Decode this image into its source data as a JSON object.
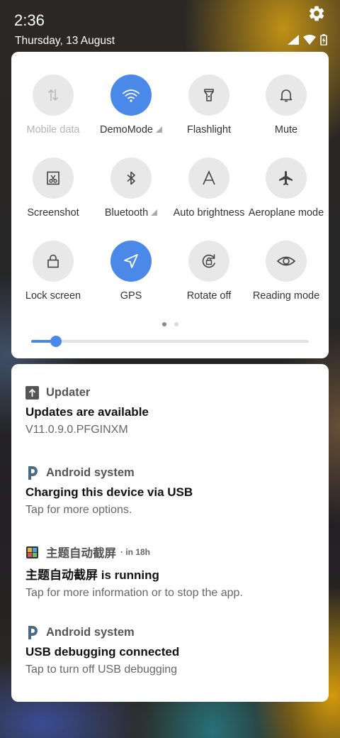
{
  "status_bar": {
    "time": "2:36",
    "date": "Thursday, 13 August"
  },
  "quick_settings": {
    "tiles": [
      {
        "label": "Mobile data",
        "icon": "mobile-data-icon",
        "active": false,
        "disabled": true
      },
      {
        "label": "DemoMode",
        "icon": "wifi-icon",
        "active": true,
        "has_menu": true
      },
      {
        "label": "Flashlight",
        "icon": "flashlight-icon",
        "active": false
      },
      {
        "label": "Mute",
        "icon": "bell-icon",
        "active": false
      },
      {
        "label": "Screenshot",
        "icon": "screenshot-icon",
        "active": false
      },
      {
        "label": "Bluetooth",
        "icon": "bluetooth-icon",
        "active": false,
        "has_menu": true
      },
      {
        "label": "Auto brightness",
        "icon": "auto-brightness-icon",
        "active": false
      },
      {
        "label": "Aeroplane mode",
        "icon": "airplane-icon",
        "active": false
      },
      {
        "label": "Lock screen",
        "icon": "lock-icon",
        "active": false
      },
      {
        "label": "GPS",
        "icon": "location-icon",
        "active": true
      },
      {
        "label": "Rotate off",
        "icon": "rotate-lock-icon",
        "active": false
      },
      {
        "label": "Reading mode",
        "icon": "eye-icon",
        "active": false
      }
    ],
    "page_count": 2,
    "current_page": 1,
    "brightness_level": 0.09,
    "accent_color": "#4b89e9"
  },
  "notifications": [
    {
      "app": "Updater",
      "icon": "updater-icon",
      "time": "",
      "title": "Updates are available",
      "text": "V11.0.9.0.PFGINXM"
    },
    {
      "app": "Android system",
      "icon": "android-system-icon",
      "time": "",
      "title": "Charging this device via USB",
      "text": "Tap for more options."
    },
    {
      "app": "主题自动截屏",
      "icon": "app-thumbnail-icon",
      "time": "· in 18h",
      "title": "主题自动截屏 is running",
      "text": "Tap for more information or to stop the app."
    },
    {
      "app": "Android system",
      "icon": "android-system-icon",
      "time": "",
      "title": "USB debugging connected",
      "text": "Tap to turn off USB debugging"
    }
  ]
}
